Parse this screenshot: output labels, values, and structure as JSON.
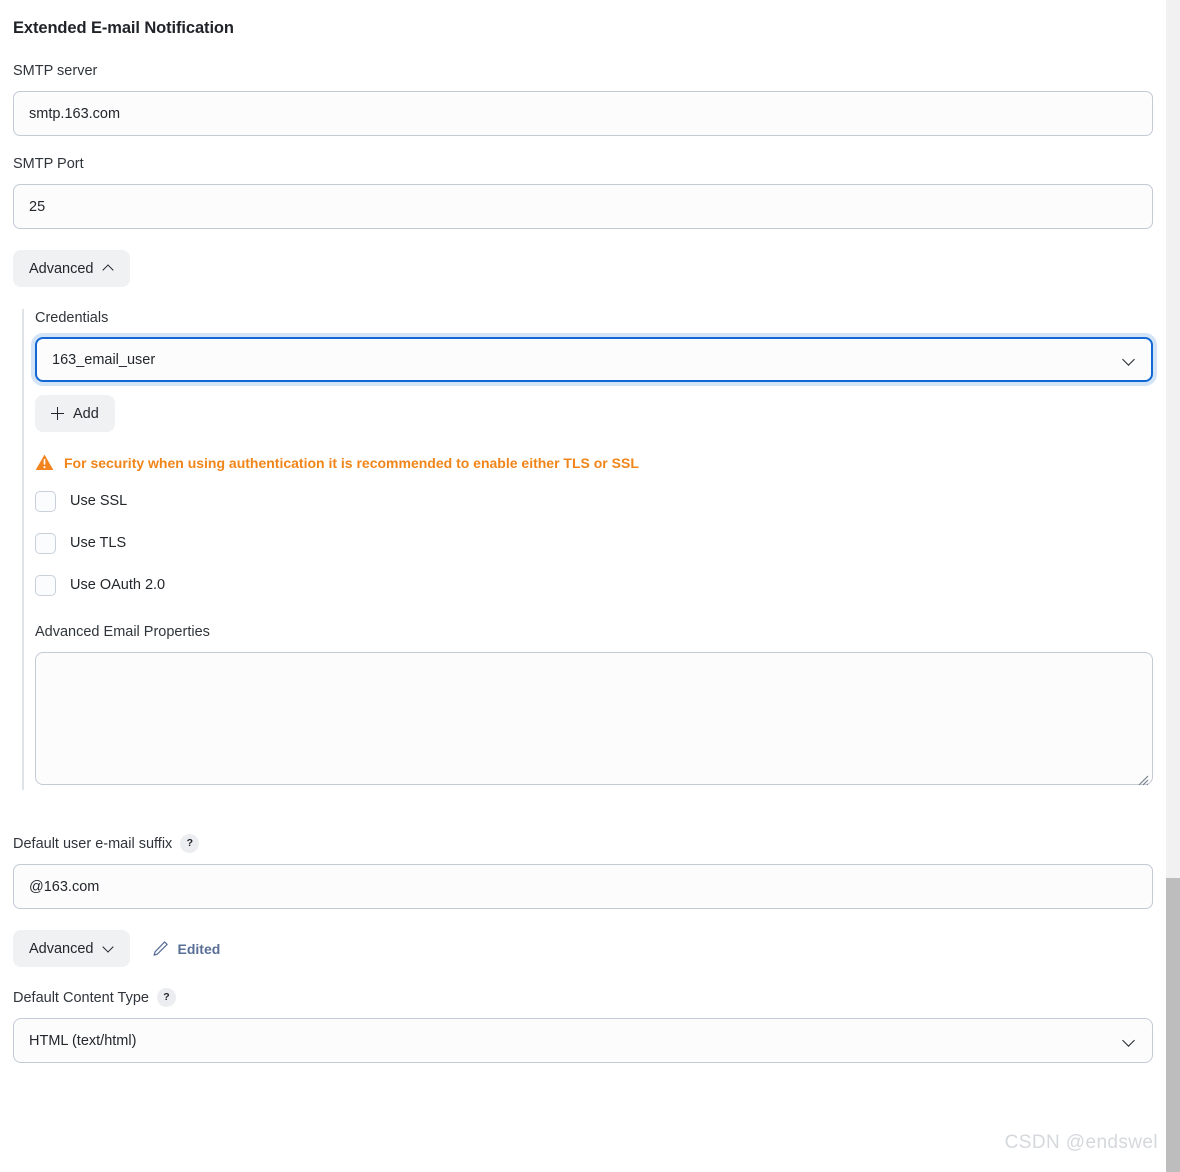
{
  "header": {
    "title": "Extended E-mail Notification"
  },
  "fields": {
    "smtp_server": {
      "label": "SMTP server",
      "value": "smtp.163.com"
    },
    "smtp_port": {
      "label": "SMTP Port",
      "value": "25"
    },
    "default_suffix": {
      "label": "Default user e-mail suffix",
      "help": "?",
      "value": "@163.com"
    },
    "default_content_type": {
      "label": "Default Content Type",
      "help": "?",
      "value": "HTML (text/html)"
    }
  },
  "advanced_top": {
    "label": "Advanced",
    "icon": "chevron-up-icon",
    "expanded": true
  },
  "advanced_bottom": {
    "label": "Advanced",
    "icon": "chevron-down-icon",
    "expanded": false
  },
  "edited": {
    "label": "Edited",
    "icon": "pencil-icon",
    "color": "#5a6f96"
  },
  "credentials": {
    "label": "Credentials",
    "value": "163_email_user",
    "dropdown_icon": "chevron-down-icon",
    "focused": true,
    "add_button": {
      "label": "Add",
      "icon": "plus-icon"
    }
  },
  "warning": {
    "icon": "warning-triangle-icon",
    "text": "For security when using authentication it is recommended to enable either TLS or SSL",
    "color": "#f08519"
  },
  "checkboxes": [
    {
      "label": "Use SSL",
      "checked": false
    },
    {
      "label": "Use TLS",
      "checked": false
    },
    {
      "label": "Use OAuth 2.0",
      "checked": false
    }
  ],
  "advanced_email_properties": {
    "label": "Advanced Email Properties",
    "value": "",
    "placeholder": ""
  },
  "watermark": {
    "text": "CSDN @endswel"
  },
  "scrollbar": {
    "orientation": "vertical"
  }
}
